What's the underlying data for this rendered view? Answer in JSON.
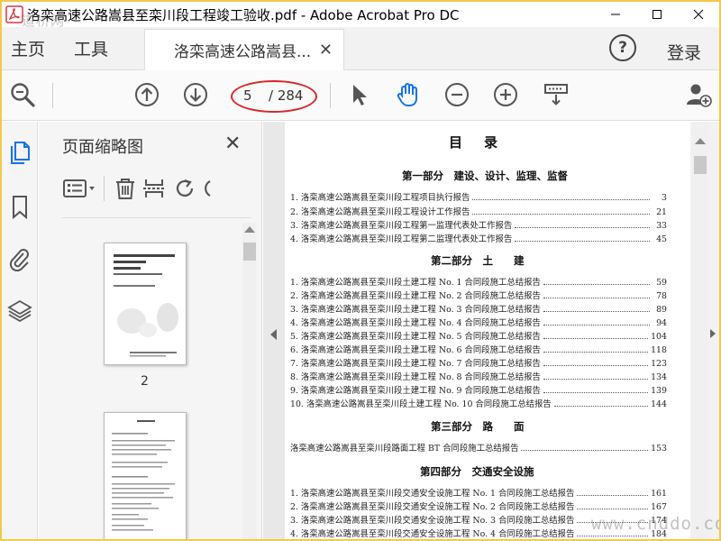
{
  "window": {
    "title": "洛栾高速公路嵩县至栾川段工程竣工验收.pdf - Adobe Acrobat Pro DC",
    "watermark_top": "道桥网",
    "watermark_bottom": "www.cnddo.com"
  },
  "menu": {
    "home": "主页",
    "tools": "工具",
    "doc_tab": "洛栾高速公路嵩县...",
    "help": "?",
    "login": "登录"
  },
  "toolbar": {
    "current_page": "5",
    "total_pages": "/ 284"
  },
  "thumbnails_panel": {
    "title": "页面缩略图",
    "thumbs": [
      {
        "label": "2"
      }
    ]
  },
  "document": {
    "toc_title": "目录",
    "sections": [
      {
        "heading": "第一部分　建设、设计、监理、监督",
        "entries": [
          {
            "text": "1. 洛栾高速公路嵩县至栾川段工程项目执行报告",
            "page": "3"
          },
          {
            "text": "2. 洛栾高速公路嵩县至栾川段工程设计工作报告",
            "page": "21"
          },
          {
            "text": "3. 洛栾高速公路嵩县至栾川段工程第一监理代表处工作报告",
            "page": "33"
          },
          {
            "text": "4. 洛栾高速公路嵩县至栾川段工程第二监理代表处工作报告",
            "page": "45"
          }
        ]
      },
      {
        "heading": "第二部分　土　　建",
        "entries": [
          {
            "text": "1. 洛栾高速公路嵩县至栾川段土建工程 No. 1 合同段施工总结报告",
            "page": "59"
          },
          {
            "text": "2. 洛栾高速公路嵩县至栾川段土建工程 No. 2 合同段施工总结报告",
            "page": "78"
          },
          {
            "text": "3. 洛栾高速公路嵩县至栾川段土建工程 No. 3 合同段施工总结报告",
            "page": "89"
          },
          {
            "text": "4. 洛栾高速公路嵩县至栾川段土建工程 No. 4 合同段施工总结报告",
            "page": "94"
          },
          {
            "text": "5. 洛栾高速公路嵩县至栾川段土建工程 No. 5 合同段施工总结报告",
            "page": "104"
          },
          {
            "text": "6. 洛栾高速公路嵩县至栾川段土建工程 No. 6 合同段施工总结报告",
            "page": "118"
          },
          {
            "text": "7. 洛栾高速公路嵩县至栾川段土建工程 No. 7 合同段施工总结报告",
            "page": "123"
          },
          {
            "text": "8. 洛栾高速公路嵩县至栾川段土建工程 No. 8 合同段施工总结报告",
            "page": "134"
          },
          {
            "text": "9. 洛栾高速公路嵩县至栾川段土建工程 No. 9 合同段施工总结报告",
            "page": "139"
          },
          {
            "text": "10. 洛栾高速公路嵩县至栾川段土建工程 No. 10 合同段施工总结报告",
            "page": "144"
          }
        ]
      },
      {
        "heading": "第三部分　路　　面",
        "entries": [
          {
            "text": "洛栾高速公路嵩县至栾川段路面工程 BT 合同段施工总结报告",
            "page": "153"
          }
        ]
      },
      {
        "heading": "第四部分　交通安全设施",
        "entries": [
          {
            "text": "1. 洛栾高速公路嵩县至栾川段交通安全设施工程 No. 1 合同段施工总结报告",
            "page": "161"
          },
          {
            "text": "2. 洛栾高速公路嵩县至栾川段交通安全设施工程 No. 2 合同段施工总结报告",
            "page": "167"
          },
          {
            "text": "3. 洛栾高速公路嵩县至栾川段交通安全设施工程 No. 3 合同段施工总结报告",
            "page": "174"
          },
          {
            "text": "4. 洛栾高速公路嵩县至栾川段交通安全设施工程 No. 4 合同段施工总结报告",
            "page": "184"
          }
        ]
      }
    ]
  },
  "colors": {
    "accent_blue": "#1473e6",
    "annotation_red": "#d9262a",
    "acrobat_red": "#d7373f"
  }
}
